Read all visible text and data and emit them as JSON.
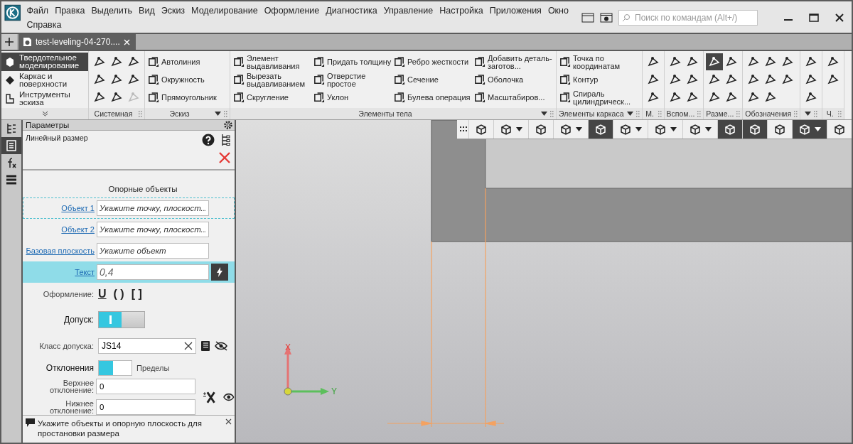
{
  "menu": [
    "Файл",
    "Правка",
    "Выделить",
    "Вид",
    "Эскиз",
    "Моделирование",
    "Оформление",
    "Диагностика",
    "Управление",
    "Настройка",
    "Приложения",
    "Окно",
    "Справка"
  ],
  "search": {
    "placeholder": "Поиск по командам (Alt+/)"
  },
  "tabs": [
    {
      "label": "test-leveling-04-270....",
      "selected": true
    }
  ],
  "modes": [
    {
      "label": "Твердотельное моделирование",
      "selected": true
    },
    {
      "label": "Каркас и поверхности",
      "selected": false
    },
    {
      "label": "Инструменты эскиза",
      "selected": false
    }
  ],
  "groups": [
    {
      "title": "Системная",
      "kind": "icons",
      "dropdown": false,
      "icons": [
        {
          "selected": false,
          "disabled": false
        },
        {
          "selected": false,
          "disabled": false
        },
        {
          "selected": false,
          "disabled": false
        },
        {
          "selected": false,
          "disabled": false
        },
        {
          "selected": false,
          "disabled": false
        },
        {
          "selected": false,
          "disabled": false
        },
        {
          "selected": false,
          "disabled": false
        },
        {
          "selected": false,
          "disabled": false
        },
        {
          "selected": false,
          "disabled": true
        }
      ]
    },
    {
      "title": "Эскиз",
      "kind": "labeled",
      "dropdown": true,
      "items": [
        "Автолиния",
        "Окружность",
        "Прямоугольник"
      ]
    },
    {
      "title": "Элементы тела",
      "kind": "labeled",
      "dropdown": true,
      "items": [
        "Элемент выдавливания",
        "Вырезать выдавливанием",
        "Скругление",
        "Придать толщину",
        "Отверстие простое",
        "Уклон",
        "Ребро жесткости",
        "Сечение",
        "Булева операция",
        "Добавить деталь-заготов...",
        "Оболочка",
        "Масштабиров..."
      ]
    },
    {
      "title": "Элементы каркаса",
      "kind": "labeled",
      "dropdown": true,
      "items": [
        "Точка по координатам",
        "Контур",
        "Спираль цилиндрическ..."
      ]
    },
    {
      "title": "М.",
      "kind": "icons",
      "dropdown": false,
      "icons": [
        {
          "selected": false,
          "disabled": false
        },
        {
          "selected": false,
          "disabled": false
        },
        {
          "selected": false,
          "disabled": false
        }
      ]
    },
    {
      "title": "Вспом...",
      "kind": "icons",
      "dropdown": false,
      "icons": [
        {
          "selected": false,
          "disabled": false
        },
        {
          "selected": false,
          "disabled": false
        },
        {
          "selected": false,
          "disabled": false
        },
        {
          "selected": false,
          "disabled": false
        },
        {
          "selected": false,
          "disabled": false
        },
        {
          "selected": false,
          "disabled": false
        }
      ]
    },
    {
      "title": "Разме...",
      "kind": "icons",
      "dropdown": false,
      "icons": [
        {
          "selected": true,
          "disabled": false
        },
        {
          "selected": false,
          "disabled": false
        },
        {
          "selected": false,
          "disabled": false
        },
        {
          "selected": false,
          "disabled": false
        },
        {
          "selected": false,
          "disabled": false
        },
        {
          "selected": false,
          "disabled": false
        }
      ]
    },
    {
      "title": "Обозначения",
      "kind": "icons",
      "dropdown": false,
      "icons": [
        {
          "selected": false,
          "disabled": false
        },
        {
          "selected": false,
          "disabled": false
        },
        {
          "selected": false,
          "disabled": false
        },
        {
          "selected": false,
          "disabled": false
        },
        {
          "selected": false,
          "disabled": false
        },
        {
          "selected": false,
          "disabled": false
        },
        {
          "selected": false,
          "disabled": false
        },
        {
          "selected": false,
          "disabled": false
        }
      ]
    },
    {
      "kind": "icons",
      "dropdown": true,
      "icons": [
        {
          "selected": false,
          "disabled": false
        },
        {
          "selected": false,
          "disabled": false
        },
        {
          "selected": false,
          "disabled": false
        }
      ]
    },
    {
      "title": "Ч.",
      "kind": "icons",
      "dropdown": false,
      "icons": [
        {
          "selected": false,
          "disabled": false
        },
        {
          "selected": false,
          "disabled": false
        }
      ]
    }
  ],
  "side_tabs": [
    {
      "selected": false
    },
    {
      "selected": true
    },
    {
      "selected": false
    },
    {
      "selected": false
    }
  ],
  "panel": {
    "title": "Параметры",
    "subtitle": "Линейный размер",
    "section": "Опорные объекты",
    "objects": [
      {
        "label": "Объект 1",
        "placeholder": "Укажите точку, плоскост...",
        "focused": true,
        "selected": false
      },
      {
        "label": "Объект 2",
        "placeholder": "Укажите точку, плоскост...",
        "focused": false,
        "selected": false
      },
      {
        "label": "Базовая плоскость",
        "placeholder": "Укажите объект",
        "focused": false,
        "selected": false
      },
      {
        "label": "Текст",
        "value": "0,4",
        "focused": false,
        "selected": true
      }
    ],
    "style_label": "Оформление:",
    "style_buttons": [
      "U",
      "( )",
      "[ ]"
    ],
    "tolerance": {
      "label": "Допуск:",
      "on": true
    },
    "tol_class": {
      "label": "Класс допуска:",
      "value": "JS14"
    },
    "deviation_mode": [
      {
        "label": "Отклонения",
        "selected": true
      },
      {
        "label": "Пределы",
        "selected": false
      }
    ],
    "upper": {
      "label": "Верхнее отклонение:",
      "value": "0"
    },
    "lower": {
      "label": "Нижнее отклонение:",
      "value": "0"
    },
    "hint": "Укажите объекты и опорную плоскость для простановки размера"
  },
  "view_toolbar": [
    {
      "selected": false,
      "dropdown": false
    },
    {
      "selected": false,
      "dropdown": true
    },
    {
      "selected": false,
      "dropdown": false
    },
    {
      "selected": false,
      "dropdown": true
    },
    {
      "selected": true,
      "dropdown": false
    },
    {
      "selected": false,
      "dropdown": true
    },
    {
      "selected": false,
      "dropdown": true
    },
    {
      "selected": false,
      "dropdown": true
    },
    {
      "selected": true,
      "dropdown": false
    },
    {
      "selected": true,
      "dropdown": false
    },
    {
      "selected": false,
      "dropdown": false
    },
    {
      "selected": true,
      "dropdown": true
    },
    {
      "selected": false,
      "dropdown": false
    }
  ],
  "axes": {
    "x": "X",
    "y": "Y"
  }
}
